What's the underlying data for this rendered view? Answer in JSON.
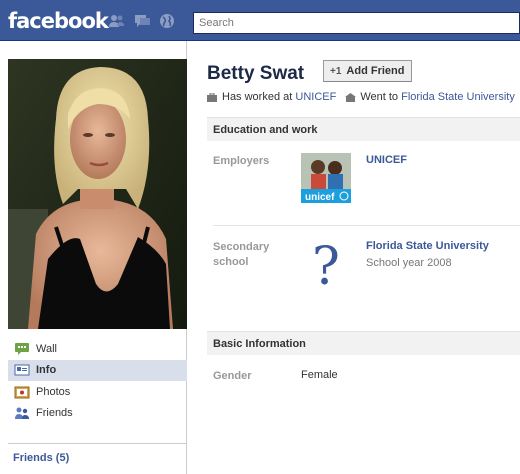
{
  "topbar": {
    "logo": "facebook",
    "search_placeholder": "Search",
    "icons": [
      "friends-requests-icon",
      "messages-icon",
      "notifications-icon"
    ]
  },
  "profile": {
    "name": "Betty Swat",
    "add_friend_label": "Add Friend",
    "summary": {
      "worked_prefix": "Has worked at",
      "worked_at": "UNICEF",
      "went_prefix": "Went to",
      "went_to": "Florida State University"
    }
  },
  "nav": {
    "items": [
      {
        "label": "Wall",
        "icon": "wall-icon"
      },
      {
        "label": "Info",
        "icon": "info-icon",
        "active": true
      },
      {
        "label": "Photos",
        "icon": "photos-icon"
      },
      {
        "label": "Friends",
        "icon": "friends-icon"
      }
    ],
    "friends_link": "Friends (5)"
  },
  "education_work": {
    "header": "Education and work",
    "employers_label": "Employers",
    "employer_name": "UNICEF",
    "employer_logo_text": "unicef",
    "secondary_label": "Secondary school",
    "school_name": "Florida State University",
    "school_year": "School year 2008"
  },
  "basic_info": {
    "header": "Basic Information",
    "gender_label": "Gender",
    "gender_value": "Female"
  },
  "colors": {
    "brand": "#3b5998",
    "name": "#1c2a47",
    "nav_active": "#d8dfea",
    "section_bg": "#f2f2f2"
  }
}
